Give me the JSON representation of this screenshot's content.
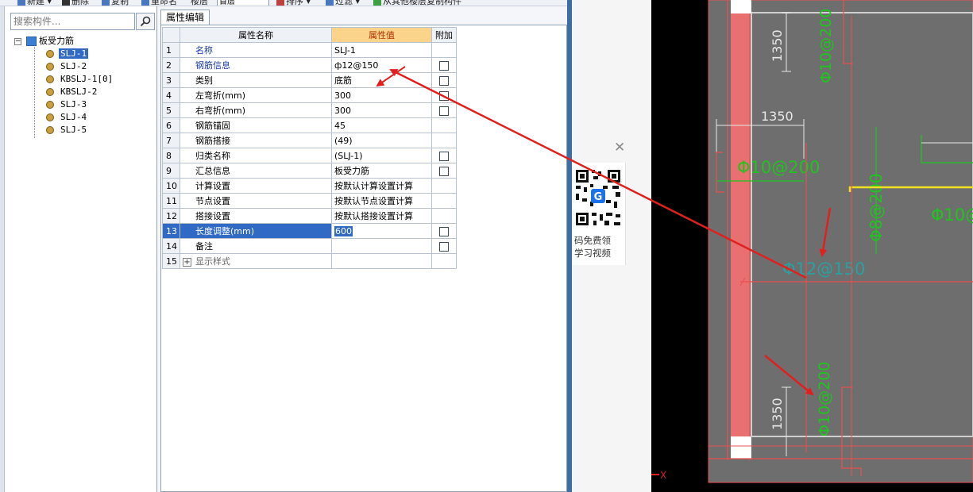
{
  "toolbar": {
    "items": [
      "新建",
      "删除",
      "复制",
      "重命名",
      "楼层"
    ],
    "floor_value": "首层",
    "sort_label": "排序",
    "filter_label": "过滤",
    "copy_from_floor_label": "从其他楼层复制构件"
  },
  "search": {
    "placeholder": "搜索构件..."
  },
  "tree": {
    "root_label": "板受力筋",
    "root_expander": "⊟",
    "items": [
      {
        "label": "SLJ-1",
        "selected": true
      },
      {
        "label": "SLJ-2",
        "selected": false
      },
      {
        "label": "KBSLJ-1[0]",
        "selected": false
      },
      {
        "label": "KBSLJ-2",
        "selected": false
      },
      {
        "label": "SLJ-3",
        "selected": false
      },
      {
        "label": "SLJ-4",
        "selected": false
      },
      {
        "label": "SLJ-5",
        "selected": false
      }
    ]
  },
  "panel": {
    "tab_label": "属性编辑"
  },
  "grid": {
    "headers": {
      "name": "属性名称",
      "value": "属性值",
      "extra": "附加"
    },
    "rows": [
      {
        "num": "1",
        "name": "名称",
        "value": "SLJ-1",
        "checkbox": false,
        "blue": true
      },
      {
        "num": "2",
        "name": "钢筋信息",
        "value": "ф12@150",
        "checkbox": true,
        "blue": true
      },
      {
        "num": "3",
        "name": "类别",
        "value": "底筋",
        "checkbox": true,
        "blue": false
      },
      {
        "num": "4",
        "name": "左弯折(mm)",
        "value": "300",
        "checkbox": true,
        "blue": false
      },
      {
        "num": "5",
        "name": "右弯折(mm)",
        "value": "300",
        "checkbox": true,
        "blue": false
      },
      {
        "num": "6",
        "name": "钢筋锚固",
        "value": "45",
        "checkbox": false,
        "blue": false
      },
      {
        "num": "7",
        "name": "钢筋搭接",
        "value": "(49)",
        "checkbox": false,
        "blue": false
      },
      {
        "num": "8",
        "name": "归类名称",
        "value": "(SLJ-1)",
        "checkbox": true,
        "blue": false
      },
      {
        "num": "9",
        "name": "汇总信息",
        "value": "板受力筋",
        "checkbox": true,
        "blue": false
      },
      {
        "num": "10",
        "name": "计算设置",
        "value": "按默认计算设置计算",
        "checkbox": false,
        "blue": false
      },
      {
        "num": "11",
        "name": "节点设置",
        "value": "按默认节点设置计算",
        "checkbox": false,
        "blue": false
      },
      {
        "num": "12",
        "name": "搭接设置",
        "value": "按默认搭接设置计算",
        "checkbox": false,
        "blue": false
      },
      {
        "num": "13",
        "name": "长度调整(mm)",
        "value": "600",
        "checkbox": true,
        "blue": false,
        "selected": true
      },
      {
        "num": "14",
        "name": "备注",
        "value": "",
        "checkbox": true,
        "blue": false
      },
      {
        "num": "15",
        "name": "显示样式",
        "value": "",
        "checkbox": false,
        "blue": false,
        "expander": "+"
      }
    ]
  },
  "promo": {
    "line1": "码免费领",
    "line2": "学习视频",
    "close": "✕"
  },
  "cad": {
    "dims": [
      "1350",
      "1350",
      "1350"
    ],
    "rebar_labels": [
      "Φ10@200",
      "Φ10@200",
      "Φ8@200",
      "Φ10@",
      "Φ12@150",
      "Φ10@200"
    ],
    "axis_label": "X",
    "colors": {
      "background": "#000000",
      "slab": "#6e6e6e",
      "dim_line": "#e8e8e8",
      "rebar_green": "#1fc41f",
      "beam_red": "#e85050",
      "highlight_yellow": "#f0e020",
      "annotation_red": "#e02020"
    }
  }
}
